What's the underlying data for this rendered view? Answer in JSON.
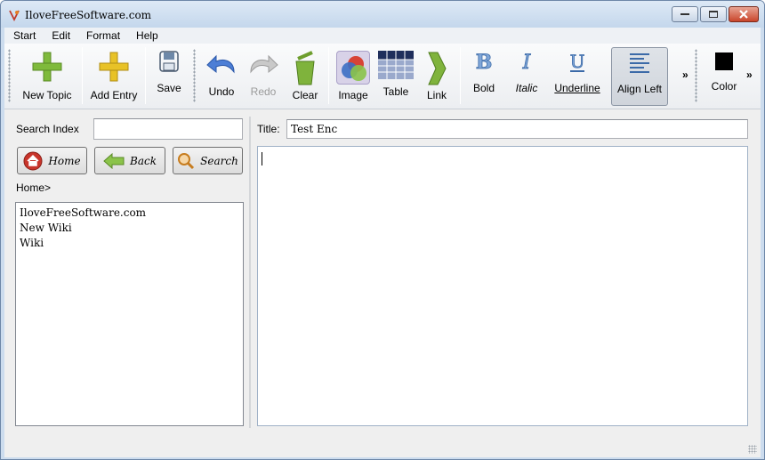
{
  "window": {
    "title": "IloveFreeSoftware.com"
  },
  "menu": [
    "Start",
    "Edit",
    "Format",
    "Help"
  ],
  "toolbar": {
    "new_topic": "New Topic",
    "add_entry": "Add Entry",
    "save": "Save",
    "undo": "Undo",
    "redo": "Redo",
    "clear": "Clear",
    "image": "Image",
    "table": "Table",
    "link": "Link",
    "bold": "Bold",
    "italic": "Italic",
    "underline": "Underline",
    "align_left": "Align Left",
    "overflow": "»",
    "color": "Color",
    "color_value": "#000000"
  },
  "sidebar": {
    "search_label": "Search Index",
    "search_value": "",
    "home_btn": "Home",
    "back_btn": "Back",
    "search_btn": "Search",
    "breadcrumb": "Home>",
    "items": [
      "IloveFreeSoftware.com",
      "New Wiki",
      "Wiki"
    ]
  },
  "editor": {
    "title_label": "Title:",
    "title_value": "Test Enc",
    "body": ""
  }
}
